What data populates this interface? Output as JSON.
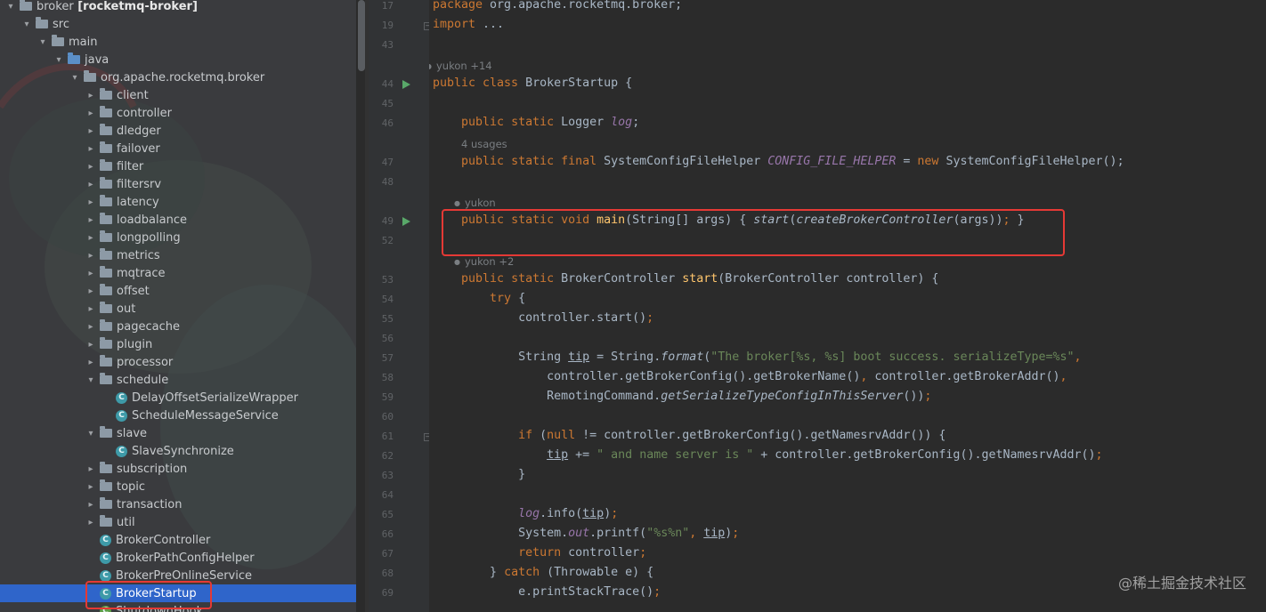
{
  "project_tree": {
    "items": [
      {
        "depth": 0,
        "kind": "module",
        "expanded": true,
        "label": "broker",
        "suffix": " [rocketmq-broker]"
      },
      {
        "depth": 1,
        "kind": "folder",
        "expanded": true,
        "label": "src"
      },
      {
        "depth": 2,
        "kind": "folder",
        "expanded": true,
        "label": "main"
      },
      {
        "depth": 3,
        "kind": "src-folder",
        "expanded": true,
        "label": "java"
      },
      {
        "depth": 4,
        "kind": "package",
        "expanded": true,
        "label": "org.apache.rocketmq.broker"
      },
      {
        "depth": 5,
        "kind": "package",
        "expanded": false,
        "label": "client"
      },
      {
        "depth": 5,
        "kind": "package",
        "expanded": false,
        "label": "controller"
      },
      {
        "depth": 5,
        "kind": "package",
        "expanded": false,
        "label": "dledger"
      },
      {
        "depth": 5,
        "kind": "package",
        "expanded": false,
        "label": "failover"
      },
      {
        "depth": 5,
        "kind": "package",
        "expanded": false,
        "label": "filter"
      },
      {
        "depth": 5,
        "kind": "package",
        "expanded": false,
        "label": "filtersrv"
      },
      {
        "depth": 5,
        "kind": "package",
        "expanded": false,
        "label": "latency"
      },
      {
        "depth": 5,
        "kind": "package",
        "expanded": false,
        "label": "loadbalance"
      },
      {
        "depth": 5,
        "kind": "package",
        "expanded": false,
        "label": "longpolling"
      },
      {
        "depth": 5,
        "kind": "package",
        "expanded": false,
        "label": "metrics"
      },
      {
        "depth": 5,
        "kind": "package",
        "expanded": false,
        "label": "mqtrace"
      },
      {
        "depth": 5,
        "kind": "package",
        "expanded": false,
        "label": "offset"
      },
      {
        "depth": 5,
        "kind": "package",
        "expanded": false,
        "label": "out"
      },
      {
        "depth": 5,
        "kind": "package",
        "expanded": false,
        "label": "pagecache"
      },
      {
        "depth": 5,
        "kind": "package",
        "expanded": false,
        "label": "plugin"
      },
      {
        "depth": 5,
        "kind": "package",
        "expanded": false,
        "label": "processor"
      },
      {
        "depth": 5,
        "kind": "package",
        "expanded": true,
        "label": "schedule"
      },
      {
        "depth": 6,
        "kind": "class",
        "label": "DelayOffsetSerializeWrapper"
      },
      {
        "depth": 6,
        "kind": "class",
        "label": "ScheduleMessageService"
      },
      {
        "depth": 5,
        "kind": "package",
        "expanded": true,
        "label": "slave"
      },
      {
        "depth": 6,
        "kind": "class",
        "label": "SlaveSynchronize"
      },
      {
        "depth": 5,
        "kind": "package",
        "expanded": false,
        "label": "subscription"
      },
      {
        "depth": 5,
        "kind": "package",
        "expanded": false,
        "label": "topic"
      },
      {
        "depth": 5,
        "kind": "package",
        "expanded": false,
        "label": "transaction"
      },
      {
        "depth": 5,
        "kind": "package",
        "expanded": false,
        "label": "util"
      },
      {
        "depth": 5,
        "kind": "class",
        "label": "BrokerController"
      },
      {
        "depth": 5,
        "kind": "class",
        "label": "BrokerPathConfigHelper"
      },
      {
        "depth": 5,
        "kind": "class",
        "label": "BrokerPreOnlineService"
      },
      {
        "depth": 5,
        "kind": "class",
        "label": "BrokerStartup",
        "selected": true
      },
      {
        "depth": 5,
        "kind": "class-green",
        "label": "ShutdownHook"
      }
    ]
  },
  "editor": {
    "lines": [
      {
        "ln": "17",
        "tokens": [
          [
            "kw",
            "package "
          ],
          [
            "",
            "org.apache.rocketmq.broker;"
          ]
        ]
      },
      {
        "ln": "19",
        "fold": true,
        "tokens": [
          [
            "kw",
            "import "
          ],
          [
            "brk",
            "..."
          ]
        ]
      },
      {
        "ln": "43",
        "tokens": []
      },
      {
        "hint": "yukon +14",
        "indent": 0
      },
      {
        "ln": "44",
        "run": true,
        "tokens": [
          [
            "kw",
            "public class "
          ],
          [
            "",
            "BrokerStartup {"
          ]
        ]
      },
      {
        "ln": "45",
        "tokens": []
      },
      {
        "ln": "46",
        "tokens": [
          [
            "",
            "    "
          ],
          [
            "kw",
            "public static "
          ],
          [
            "",
            "Logger "
          ],
          [
            "fld",
            "log"
          ],
          [
            "",
            ";"
          ]
        ]
      },
      {
        "hint": "4 usages",
        "indent": 4
      },
      {
        "ln": "47",
        "tokens": [
          [
            "",
            "    "
          ],
          [
            "kw",
            "public static final "
          ],
          [
            "",
            "SystemConfigFileHelper "
          ],
          [
            "fld",
            "CONFIG_FILE_HELPER"
          ],
          [
            "",
            " = "
          ],
          [
            "kw",
            "new "
          ],
          [
            "",
            "SystemConfigFileHelper();"
          ]
        ]
      },
      {
        "ln": "48",
        "tokens": []
      },
      {
        "hint": "yukon",
        "indent": 4
      },
      {
        "ln": "49",
        "run": true,
        "tokens": [
          [
            "",
            "    "
          ],
          [
            "kw",
            "public static void "
          ],
          [
            "fn",
            "main"
          ],
          [
            "",
            "(String[] args) { "
          ],
          [
            "it",
            "start"
          ],
          [
            "",
            "("
          ],
          [
            "it",
            "createBrokerController"
          ],
          [
            "",
            "(args))"
          ],
          [
            "kw",
            ";"
          ],
          [
            "",
            " }"
          ]
        ]
      },
      {
        "ln": "52",
        "tokens": []
      },
      {
        "hint": "yukon +2",
        "indent": 4
      },
      {
        "ln": "53",
        "tokens": [
          [
            "",
            "    "
          ],
          [
            "kw",
            "public static "
          ],
          [
            "",
            "BrokerController "
          ],
          [
            "fn",
            "start"
          ],
          [
            "",
            "(BrokerController controller) {"
          ]
        ]
      },
      {
        "ln": "54",
        "tokens": [
          [
            "",
            "        "
          ],
          [
            "kw",
            "try "
          ],
          [
            "",
            "{"
          ]
        ]
      },
      {
        "ln": "55",
        "tokens": [
          [
            "",
            "            controller.start()"
          ],
          [
            "kw",
            ";"
          ]
        ]
      },
      {
        "ln": "56",
        "tokens": []
      },
      {
        "ln": "57",
        "tokens": [
          [
            "",
            "            String "
          ],
          [
            "ul",
            "tip"
          ],
          [
            "",
            " = String."
          ],
          [
            "it",
            "format"
          ],
          [
            "",
            "("
          ],
          [
            "st",
            "\"The broker[%s, %s] boot success. serializeType=%s\""
          ],
          [
            "kw",
            ","
          ]
        ]
      },
      {
        "ln": "58",
        "tokens": [
          [
            "",
            "                controller.getBrokerConfig().getBrokerName()"
          ],
          [
            "kw",
            ", "
          ],
          [
            "",
            "controller.getBrokerAddr()"
          ],
          [
            "kw",
            ","
          ]
        ]
      },
      {
        "ln": "59",
        "tokens": [
          [
            "",
            "                RemotingCommand."
          ],
          [
            "it",
            "getSerializeTypeConfigInThisServer"
          ],
          [
            "",
            "())"
          ],
          [
            "kw",
            ";"
          ]
        ]
      },
      {
        "ln": "60",
        "tokens": []
      },
      {
        "ln": "61",
        "fold": true,
        "tokens": [
          [
            "",
            "            "
          ],
          [
            "kw",
            "if "
          ],
          [
            "",
            "("
          ],
          [
            "kw",
            "null "
          ],
          [
            "",
            "!= controller.getBrokerConfig().getNamesrvAddr()) {"
          ]
        ]
      },
      {
        "ln": "62",
        "tokens": [
          [
            "",
            "                "
          ],
          [
            "ul",
            "tip"
          ],
          [
            "",
            " += "
          ],
          [
            "st",
            "\" and name server is \""
          ],
          [
            "",
            " + controller.getBrokerConfig().getNamesrvAddr()"
          ],
          [
            "kw",
            ";"
          ]
        ]
      },
      {
        "ln": "63",
        "tokens": [
          [
            "",
            "            }"
          ]
        ]
      },
      {
        "ln": "64",
        "tokens": []
      },
      {
        "ln": "65",
        "tokens": [
          [
            "",
            "            "
          ],
          [
            "fld",
            "log"
          ],
          [
            "",
            ".info("
          ],
          [
            "ul",
            "tip"
          ],
          [
            "",
            ")"
          ],
          [
            "kw",
            ";"
          ]
        ]
      },
      {
        "ln": "66",
        "tokens": [
          [
            "",
            "            System."
          ],
          [
            "fld",
            "out"
          ],
          [
            "",
            ".printf("
          ],
          [
            "st",
            "\"%s%n\""
          ],
          [
            "kw",
            ", "
          ],
          [
            "ul",
            "tip"
          ],
          [
            "",
            ")"
          ],
          [
            "kw",
            ";"
          ]
        ]
      },
      {
        "ln": "67",
        "tokens": [
          [
            "",
            "            "
          ],
          [
            "kw",
            "return "
          ],
          [
            "",
            "controller"
          ],
          [
            "kw",
            ";"
          ]
        ]
      },
      {
        "ln": "68",
        "tokens": [
          [
            "",
            "        } "
          ],
          [
            "kw",
            "catch "
          ],
          [
            "",
            "(Throwable e) {"
          ]
        ]
      },
      {
        "ln": "69",
        "tokens": [
          [
            "",
            "            e.printStackTrace()"
          ],
          [
            "kw",
            ";"
          ]
        ]
      }
    ]
  },
  "watermark": "@稀土掘金技术社区",
  "colors": {
    "highlight_box": "#e53935",
    "selection": "#2f65ca",
    "keyword": "#cc7832",
    "function": "#ffc66d",
    "string": "#6a8759",
    "field": "#9876aa"
  }
}
